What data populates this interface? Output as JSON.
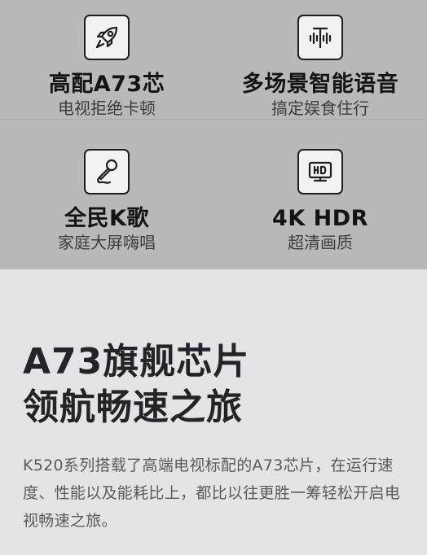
{
  "features": [
    {
      "icon": "rocket-icon",
      "title": "高配A73芯",
      "subtitle": "电视拒绝卡顿"
    },
    {
      "icon": "voice-icon",
      "title": "多场景智能语音",
      "subtitle": "搞定娱食住行"
    },
    {
      "icon": "microphone-icon",
      "title": "全民K歌",
      "subtitle": "家庭大屏嗨唱"
    },
    {
      "icon": "hd-tv-icon",
      "title": "4K HDR",
      "subtitle": "超清画质"
    }
  ],
  "section": {
    "headline_line1": "A73旗舰芯片",
    "headline_line2": "领航畅速之旅",
    "body": "K520系列搭载了高端电视标配的A73芯片，在运行速度、性能以及能耗比上，都比以往更胜一筹轻松开启电视畅速之旅。"
  },
  "colors": {
    "top_background": "#b9b9bc",
    "bottom_background": "#e4e4e6",
    "headline": "#232329",
    "body_text": "#5a5a5e"
  }
}
